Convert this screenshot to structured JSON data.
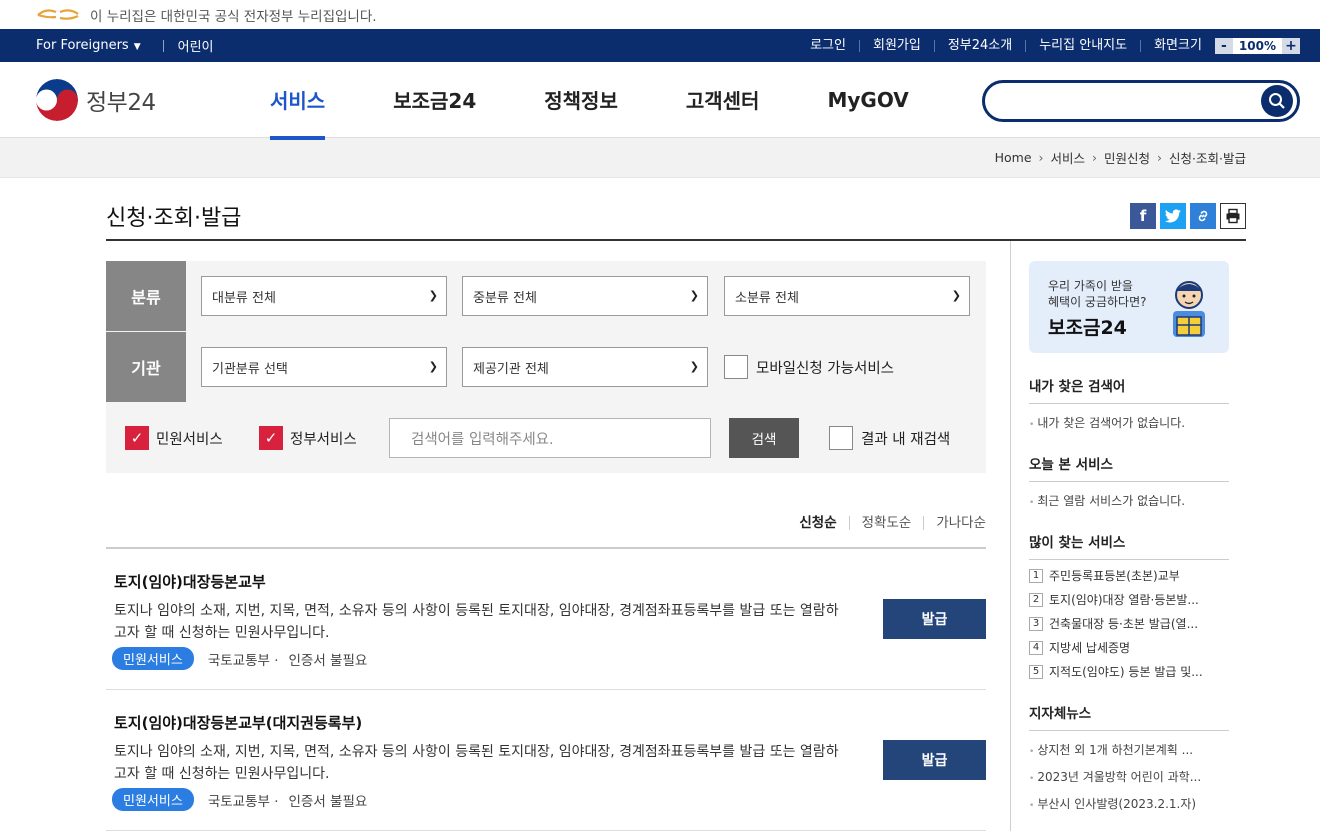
{
  "banner": {
    "text": "이 누리집은 대한민국 공식 전자정부 누리집입니다."
  },
  "util": {
    "foreigners": "For Foreigners",
    "kids": "어린이",
    "links": [
      "로그인",
      "회원가입",
      "정부24소개",
      "누리집 안내지도",
      "화면크기"
    ],
    "zoom_minus": "-",
    "zoom_value": "100%",
    "zoom_plus": "+"
  },
  "header": {
    "logo": "정부24",
    "menu": [
      "서비스",
      "보조금24",
      "정책정보",
      "고객센터",
      "MyGOV"
    ],
    "active_menu": "서비스"
  },
  "breadcrumb": [
    "Home",
    "서비스",
    "민원신청",
    "신청·조회·발급"
  ],
  "page_title": "신청·조회·발급",
  "filter": {
    "label_category": "분류",
    "label_agency": "기관",
    "cat_large": "대분류 전체",
    "cat_mid": "중분류 전체",
    "cat_small": "소분류 전체",
    "agency_type": "기관분류 선택",
    "agency": "제공기관 전체",
    "mobile_label": "모바일신청 가능서비스",
    "civil_label": "민원서비스",
    "gov_label": "정부서비스",
    "keyword_placeholder": "검색어를 입력해주세요.",
    "search_btn": "검색",
    "research_label": "결과 내 재검색"
  },
  "sort": [
    "신청순",
    "정확도순",
    "가나다순"
  ],
  "results": [
    {
      "title": "토지(임야)대장등본교부",
      "desc": "토지나 임야의 소재, 지번, 지목, 면적, 소유자 등의 사항이 등록된 토지대장, 임야대장, 경계점좌표등록부를 발급 또는 열람하고자 할 때 신청하는 민원사무입니다.",
      "tag": "민원서비스",
      "agency": "국토교통부 ·",
      "auth": "인증서 불필요",
      "action": "발급"
    },
    {
      "title": "토지(임야)대장등본교부(대지권등록부)",
      "desc": "토지나 임야의 소재, 지번, 지목, 면적, 소유자 등의 사항이 등록된 토지대장, 임야대장, 경계점좌표등록부를 발급 또는 열람하고자 할 때 신청하는 민원사무입니다.",
      "tag": "민원서비스",
      "agency": "국토교통부 ·",
      "auth": "인증서 불필요",
      "action": "발급"
    }
  ],
  "sidebar": {
    "promo_line1": "우리 가족이 받을",
    "promo_line2": "혜택이 궁금하다면?",
    "promo_big": "보조금24",
    "my_keywords_title": "내가 찾은 검색어",
    "my_keywords_empty": "내가 찾은 검색어가 없습니다.",
    "today_title": "오늘 본 서비스",
    "today_empty": "최근 열람 서비스가 없습니다.",
    "popular_title": "많이 찾는 서비스",
    "popular": [
      {
        "n": "1",
        "label": "주민등록표등본(초본)교부"
      },
      {
        "n": "2",
        "label": "토지(임야)대장 열람·등본발..."
      },
      {
        "n": "3",
        "label": "건축물대장 등·초본 발급(열..."
      },
      {
        "n": "4",
        "label": "지방세 납세증명"
      },
      {
        "n": "5",
        "label": "지적도(임야도) 등본 발급 및..."
      }
    ],
    "news_title": "지자체뉴스",
    "news": [
      "상지천 외 1개 하천기본계획 ...",
      "2023년 겨울방학 어린이 과학...",
      "부산시 인사발령(2023.2.1.자)"
    ]
  },
  "colors": {
    "navy": "#0b2d6e",
    "accent": "#1e56c9",
    "check": "#d8223d",
    "tag": "#2b7de1",
    "action": "#23457a"
  }
}
